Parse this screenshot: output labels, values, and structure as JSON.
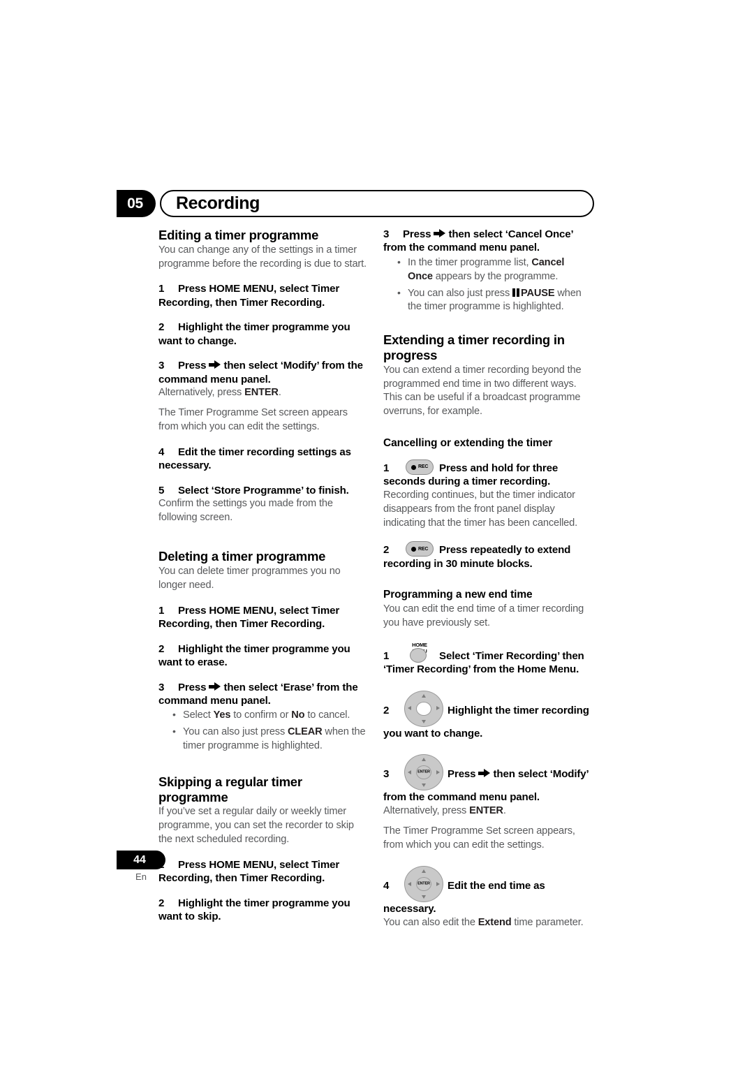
{
  "header": {
    "chapter_number": "05",
    "title": "Recording"
  },
  "footer": {
    "page_number": "44",
    "language": "En"
  },
  "left_column": {
    "section1": {
      "heading": "Editing a timer programme",
      "intro": "You can change any of the settings in a timer programme before the recording is due to start.",
      "step1_num": "1",
      "step1_text": "Press HOME MENU, select Timer Recording, then Timer Recording.",
      "step2_num": "2",
      "step2_text": "Highlight the timer programme you want to change.",
      "step3_num": "3",
      "step3_pre": "Press",
      "step3_post": "then select ‘Modify’ from the command menu panel.",
      "step3_note_pre": "Alternatively, press ",
      "step3_note_bold": "ENTER",
      "step3_note_post": ".",
      "step3_body": "The Timer Programme Set screen appears from which you can edit the settings.",
      "step4_num": "4",
      "step4_text": "Edit the timer recording settings as necessary.",
      "step5_num": "5",
      "step5_text": "Select ‘Store Programme’ to finish.",
      "step5_body": "Confirm the settings you made from the following screen."
    },
    "section2": {
      "heading": "Deleting a timer programme",
      "intro": "You can delete timer programmes you no longer need.",
      "step1_num": "1",
      "step1_text": "Press HOME MENU, select Timer Recording, then Timer Recording.",
      "step2_num": "2",
      "step2_text": "Highlight the timer programme you want to erase.",
      "step3_num": "3",
      "step3_pre": "Press",
      "step3_post": "then select ‘Erase’ from the command menu panel.",
      "bullet1_pre": "Select ",
      "bullet1_b1": "Yes",
      "bullet1_mid": " to confirm or ",
      "bullet1_b2": "No",
      "bullet1_post": " to cancel.",
      "bullet2_pre": "You can also just press ",
      "bullet2_b1": "CLEAR",
      "bullet2_post": " when the timer programme is highlighted."
    },
    "section3": {
      "heading": "Skipping a regular timer programme",
      "intro": "If you’ve set a regular daily or weekly timer programme, you can set the recorder to skip the next scheduled recording.",
      "step1_num": "1",
      "step1_text": "Press HOME MENU, select Timer Recording, then Timer Recording.",
      "step2_num": "2",
      "step2_text": "Highlight the timer programme you want to skip."
    }
  },
  "right_column": {
    "continued": {
      "step3_num": "3",
      "step3_pre": "Press",
      "step3_post": "then select ‘Cancel Once’ from the command menu panel.",
      "bullet1_pre": "In the timer programme list, ",
      "bullet1_b1": "Cancel Once",
      "bullet1_post": " appears by the programme.",
      "bullet2_pre": "You can also just press ",
      "bullet2_b1": "PAUSE",
      "bullet2_post": " when the timer programme is highlighted."
    },
    "section1": {
      "heading": "Extending a timer recording in progress",
      "intro": "You can extend a timer recording beyond the programmed end time in two different ways. This can be useful if a broadcast programme overruns, for example.",
      "sub1_heading": "Cancelling or extending the timer",
      "sub1_step1_num": "1",
      "sub1_step1_icon": "rec-button-icon",
      "sub1_step1_icon_label": "REC",
      "sub1_step1_text": "Press and hold for three seconds during a timer recording.",
      "sub1_step1_body": "Recording continues, but the timer indicator disappears from the front panel display indicating that the timer has been cancelled.",
      "sub1_step2_num": "2",
      "sub1_step2_icon": "rec-button-icon",
      "sub1_step2_icon_label": "REC",
      "sub1_step2_text": "Press repeatedly to extend recording in 30 minute blocks.",
      "sub2_heading": "Programming a new end time",
      "sub2_intro": "You can edit the end time of a timer recording you have previously set.",
      "sub2_step1_num": "1",
      "sub2_step1_icon": "home-menu-button-icon",
      "sub2_step1_icon_label": "HOME MENU",
      "sub2_step1_text": "Select ‘Timer Recording’ then ‘Timer Recording’ from the Home Menu.",
      "sub2_step2_num": "2",
      "sub2_step2_icon": "dpad-icon",
      "sub2_step2_text": "Highlight the timer recording you want to change.",
      "sub2_step3_num": "3",
      "sub2_step3_icon": "dpad-enter-icon",
      "sub2_step3_icon_label": "ENTER",
      "sub2_step3_pre": "Press",
      "sub2_step3_post": "then select ‘Modify’ from the command menu panel.",
      "sub2_step3_note_pre": "Alternatively, press ",
      "sub2_step3_note_bold": "ENTER",
      "sub2_step3_note_post": ".",
      "sub2_step3_body": "The Timer Programme Set screen appears, from which you can edit the settings.",
      "sub2_step4_num": "4",
      "sub2_step4_icon": "dpad-enter-icon",
      "sub2_step4_icon_label": "ENTER",
      "sub2_step4_text": "Edit the end time as necessary.",
      "sub2_step4_body_pre": "You can also edit the ",
      "sub2_step4_body_bold": "Extend",
      "sub2_step4_body_post": " time parameter."
    }
  },
  "colors": {
    "text": "#231f20",
    "body_text": "#58595b",
    "accent_black": "#000000",
    "button_gray": "#c9c9c9"
  }
}
